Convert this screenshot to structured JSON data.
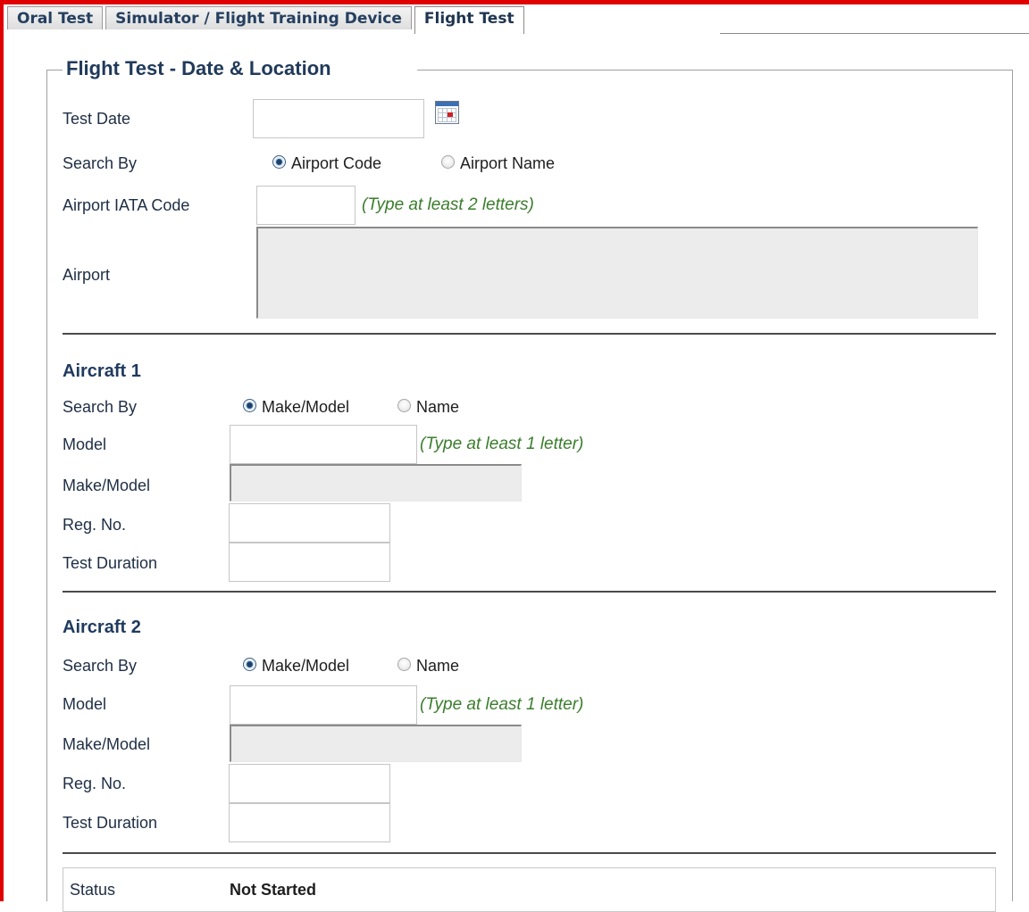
{
  "tabs": [
    {
      "label": "Oral Test",
      "active": false
    },
    {
      "label": "Simulator / Flight Training Device",
      "active": false
    },
    {
      "label": "Flight Test",
      "active": true
    }
  ],
  "location_section": {
    "legend": "Flight Test - Date & Location",
    "test_date_label": "Test Date",
    "test_date_value": "",
    "search_by_label": "Search By",
    "search_options": [
      {
        "label": "Airport Code",
        "selected": true
      },
      {
        "label": "Airport Name",
        "selected": false
      }
    ],
    "airport_code_label": "Airport IATA Code",
    "airport_code_value": "",
    "airport_code_hint": "(Type at least 2 letters)",
    "airport_label": "Airport",
    "airport_value": ""
  },
  "aircraft": [
    {
      "title": "Aircraft 1",
      "search_by_label": "Search By",
      "search_options": [
        {
          "label": "Make/Model",
          "selected": true
        },
        {
          "label": "Name",
          "selected": false
        }
      ],
      "model_label": "Model",
      "model_value": "",
      "model_hint": "(Type at least 1 letter)",
      "make_model_label": "Make/Model",
      "make_model_value": "",
      "reg_no_label": "Reg. No.",
      "reg_no_value": "",
      "duration_label": "Test Duration",
      "duration_value": ""
    },
    {
      "title": "Aircraft 2",
      "search_by_label": "Search By",
      "search_options": [
        {
          "label": "Make/Model",
          "selected": true
        },
        {
          "label": "Name",
          "selected": false
        }
      ],
      "model_label": "Model",
      "model_value": "",
      "model_hint": "(Type at least 1 letter)",
      "make_model_label": "Make/Model",
      "make_model_value": "",
      "reg_no_label": "Reg. No.",
      "reg_no_value": "",
      "duration_label": "Test Duration",
      "duration_value": ""
    }
  ],
  "status": {
    "label": "Status",
    "value": "Not Started"
  },
  "colors": {
    "frame": "#e00000",
    "heading": "#1f3a5f",
    "hint": "#3a7d2c"
  }
}
